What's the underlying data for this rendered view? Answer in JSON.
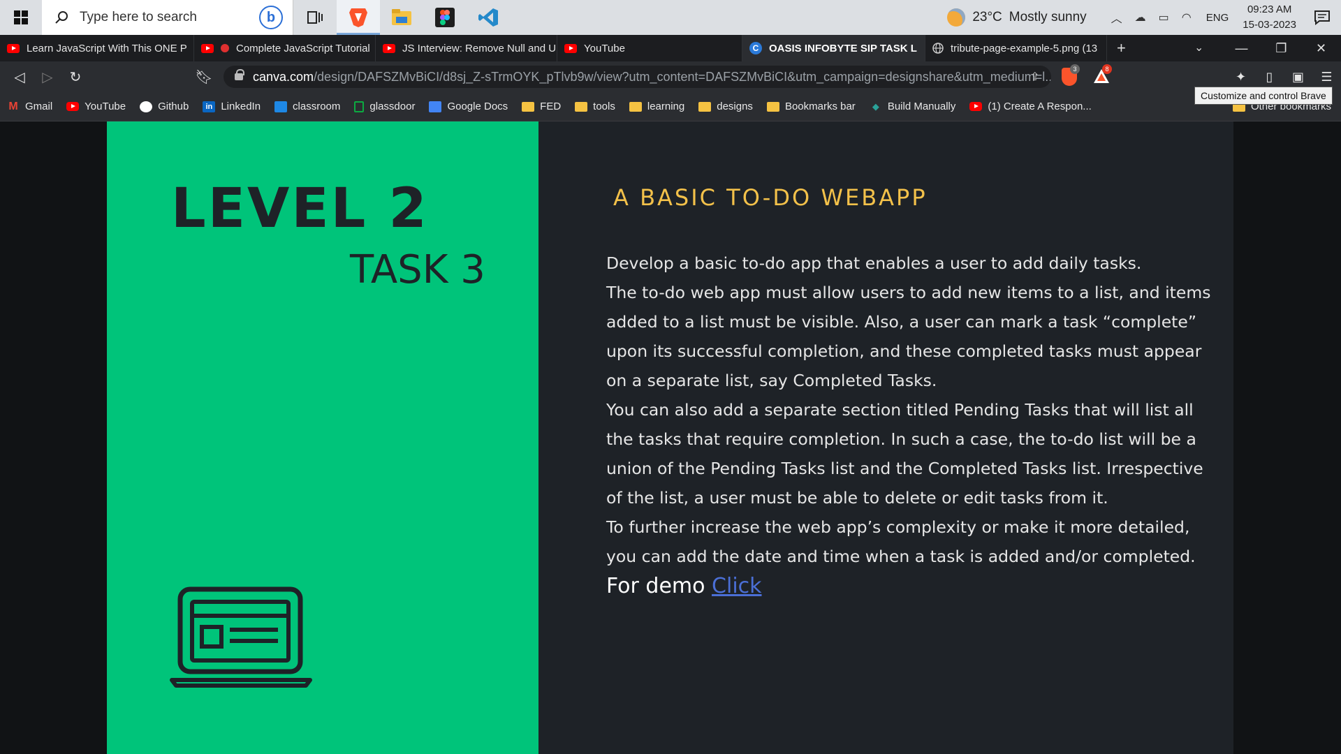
{
  "taskbar": {
    "search_placeholder": "Type here to search",
    "weather": {
      "temp": "23°C",
      "condition": "Mostly sunny"
    },
    "language": "ENG",
    "time": "09:23 AM",
    "date": "15-03-2023"
  },
  "tabs": [
    {
      "label": "Learn JavaScript With This ONE P",
      "icon": "youtube-icon",
      "active": false
    },
    {
      "label": "Complete JavaScript Tutorial",
      "icon": "youtube-icon",
      "active": false
    },
    {
      "label": "JS Interview: Remove Null and Ur",
      "icon": "youtube-icon",
      "active": false
    },
    {
      "label": "YouTube",
      "icon": "youtube-icon",
      "active": false
    },
    {
      "label": "OASIS INFOBYTE SIP TASK L",
      "icon": "canva-icon",
      "active": true
    },
    {
      "label": "tribute-page-example-5.png (13",
      "icon": "globe-icon",
      "active": false
    }
  ],
  "address": {
    "host": "canva.com",
    "path": "/design/DAFSZMvBiCI/d8sj_Z-sTrmOYK_pTlvb9w/view?utm_content=DAFSZMvBiCI&utm_campaign=designshare&utm_medium=l..."
  },
  "tooltip": "Customize and control Brave",
  "badges": {
    "shield": "3",
    "rewards": "8"
  },
  "bookmarks": [
    {
      "label": "Gmail",
      "icon": "gmail-icon"
    },
    {
      "label": "YouTube",
      "icon": "youtube-icon"
    },
    {
      "label": "Github",
      "icon": "github-icon"
    },
    {
      "label": "LinkedIn",
      "icon": "linkedin-icon"
    },
    {
      "label": "classroom",
      "icon": "classroom-icon"
    },
    {
      "label": "glassdoor",
      "icon": "glassdoor-icon"
    },
    {
      "label": "Google Docs",
      "icon": "google-docs-icon"
    },
    {
      "label": "FED",
      "icon": "folder-icon"
    },
    {
      "label": "tools",
      "icon": "folder-icon"
    },
    {
      "label": "learning",
      "icon": "folder-icon"
    },
    {
      "label": "designs",
      "icon": "folder-icon"
    },
    {
      "label": "Bookmarks bar",
      "icon": "folder-icon"
    },
    {
      "label": "Build Manually",
      "icon": "build-icon"
    },
    {
      "label": "(1) Create A Respon...",
      "icon": "youtube-icon"
    }
  ],
  "other_bookmarks": "Other bookmarks",
  "slide": {
    "level": "LEVEL 2",
    "task": "TASK 3",
    "heading": "A BASIC TO-DO WEBAPP",
    "lines": [
      " Develop a basic to-do app that enables a user to add daily tasks.",
      "The to-do web app must allow users to add new items to a list, and items",
      "added to a list must be visible. Also, a user can mark a task “complete”",
      "upon its successful completion, and these completed tasks must appear",
      "on a separate list, say Completed Tasks.",
      "You can also add a separate section titled Pending Tasks that will list all",
      "the tasks that require completion. In such a case, the to-do list will be a",
      "union of the Pending Tasks list and the Completed Tasks list. Irrespective",
      "of the list, a user must be able to delete or edit tasks from it.",
      "To further increase the web app’s complexity or make it more detailed,",
      "you can add the date and time when a task is added and/or completed."
    ],
    "demo_label": "For demo ",
    "demo_link": "Click"
  },
  "colors": {
    "green": "#00c47a",
    "dark": "#1e2227",
    "heading": "#f3c14a",
    "link": "#4b6fd6"
  }
}
